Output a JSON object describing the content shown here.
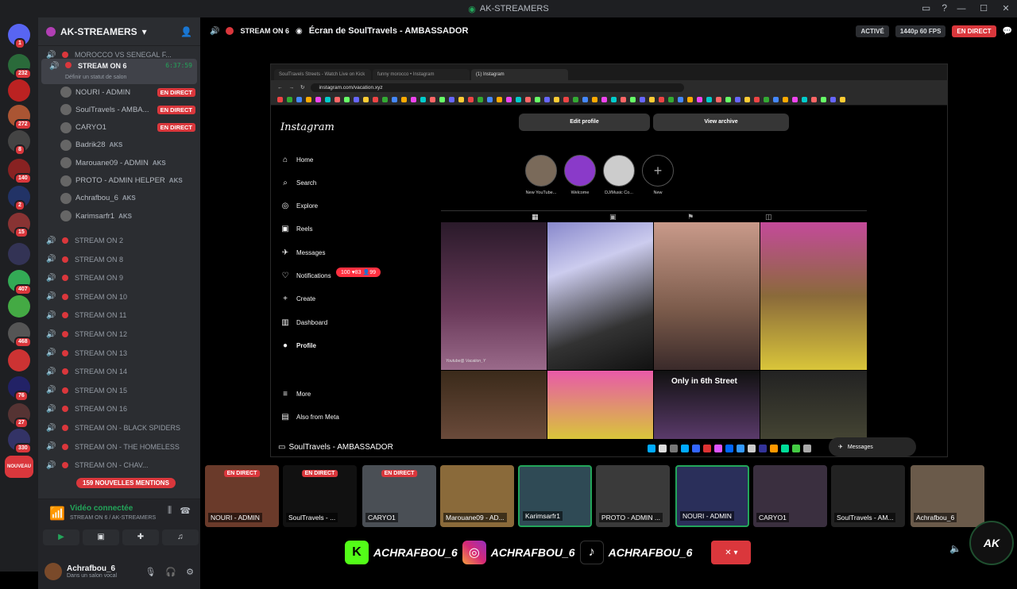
{
  "app": {
    "title": "AK-STREAMERS"
  },
  "colors": {
    "accent_red": "#da373c",
    "green": "#23a55a",
    "bg_dark": "#1e1f22",
    "panel": "#2b2d31"
  },
  "servers": [
    {
      "badge": "1",
      "color": "#5865f2",
      "icon": "discord-icon"
    },
    {
      "badge": "232",
      "color": "#2a6a3a"
    },
    {
      "badge": "",
      "color": "#b22"
    },
    {
      "badge": "272",
      "color": "#a53"
    },
    {
      "badge": "8",
      "color": "#444"
    },
    {
      "badge": "140",
      "color": "#822"
    },
    {
      "badge": "2",
      "color": "#236"
    },
    {
      "badge": "15",
      "color": "#833"
    },
    {
      "badge": "",
      "color": "#335"
    },
    {
      "badge": "407",
      "color": "#3a5"
    },
    {
      "badge": "",
      "color": "#4a4"
    },
    {
      "badge": "468",
      "color": "#555"
    },
    {
      "badge": "",
      "color": "#c33"
    },
    {
      "badge": "76",
      "color": "#226"
    },
    {
      "badge": "27",
      "color": "#533"
    },
    {
      "badge": "330",
      "color": "#336"
    },
    {
      "badge": "NOUVEAU",
      "color": "#da373c"
    }
  ],
  "guild": {
    "name": "AK-STREAMERS"
  },
  "channels": {
    "top": "MOROCCO VS SENEGAL F...",
    "active": {
      "name": "STREAM ON 6",
      "time": "6:37:59",
      "status": "Définir un statut de salon"
    },
    "users": [
      {
        "name": "NOURI - ADMIN",
        "tag": "",
        "live": "EN DIRECT"
      },
      {
        "name": "SoulTravels - AMBA...",
        "tag": "",
        "live": "EN DIRECT"
      },
      {
        "name": "CARYO1",
        "tag": "",
        "live": "EN DIRECT"
      },
      {
        "name": "Badrik28",
        "tag": "AKS",
        "live": ""
      },
      {
        "name": "Marouane09 - ADMIN",
        "tag": "AKS",
        "live": ""
      },
      {
        "name": "PROTO - ADMIN HELPER",
        "tag": "AKS",
        "live": ""
      },
      {
        "name": "Achrafbou_6",
        "tag": "AKS",
        "live": ""
      },
      {
        "name": "Karimsarfr1",
        "tag": "AKS",
        "live": ""
      }
    ],
    "others": [
      "STREAM ON 2",
      "STREAM ON 8",
      "STREAM ON 9",
      "STREAM ON 10",
      "STREAM ON 11",
      "STREAM ON 12",
      "STREAM ON 13",
      "STREAM ON 14",
      "STREAM ON 15",
      "STREAM ON 16",
      "STREAM ON - BLACK SPIDERS",
      "STREAM ON - THE HOMELESS",
      "STREAM ON - CHAV..."
    ],
    "mentions": "159 NOUVELLES MENTIONS"
  },
  "voice": {
    "connected": "Vidéo connectée",
    "sub": "STREAM ON 6 / AK-STREAMERS"
  },
  "user": {
    "name": "Achrafbou_6",
    "status": "Dans un salon vocal"
  },
  "stage": {
    "stream": "STREAM ON 6",
    "ecran": "Écran de SoulTravels - AMBASSADOR",
    "active": "ACTIVÉ",
    "quality": "1440p 60 FPS",
    "live": "EN DIRECT"
  },
  "browser": {
    "tabs": [
      "SoulTravels Streets - Watch Live on Kick",
      "funny morocco • Instagram",
      "(1) Instagram"
    ],
    "url": "instagram.com/vacation.xyz"
  },
  "instagram": {
    "logo": "Instagram",
    "nav": [
      {
        "icon": "home-icon",
        "glyph": "⌂",
        "label": "Home"
      },
      {
        "icon": "search-icon",
        "glyph": "⌕",
        "label": "Search"
      },
      {
        "icon": "explore-icon",
        "glyph": "◎",
        "label": "Explore"
      },
      {
        "icon": "reels-icon",
        "glyph": "▣",
        "label": "Reels"
      },
      {
        "icon": "messages-icon",
        "glyph": "✈",
        "label": "Messages"
      },
      {
        "icon": "heart-icon",
        "glyph": "♡",
        "label": "Notifications"
      },
      {
        "icon": "create-icon",
        "glyph": "+",
        "label": "Create"
      },
      {
        "icon": "dashboard-icon",
        "glyph": "▥",
        "label": "Dashboard"
      },
      {
        "icon": "avatar-icon",
        "glyph": "●",
        "label": "Profile"
      }
    ],
    "more": "More",
    "meta": "Also from Meta",
    "notif_badge": "100 ♥83 👤99",
    "edit_profile": "Edit profile",
    "view_archive": "View archive",
    "highlights": [
      "New YouTube...",
      "Welcome",
      "DJ/Music Co...",
      "New"
    ],
    "post_caption": "Only in 6th Street",
    "messages": "Messages"
  },
  "sharebar": {
    "label": "SoulTravels - AMBASSADOR"
  },
  "thumbs": [
    {
      "name": "NOURI - ADMIN",
      "live": "EN DIRECT",
      "color": "#6a3a2a"
    },
    {
      "name": "SoulTravels - ...",
      "live": "EN DIRECT",
      "color": "#111"
    },
    {
      "name": "CARYO1",
      "live": "EN DIRECT",
      "color": "#4a4f55"
    },
    {
      "name": "Marouane09 - AD...",
      "live": "",
      "color": "#8a6a3a"
    },
    {
      "name": "Karimsarfr1",
      "live": "",
      "color": "#2f4a55"
    },
    {
      "name": "PROTO - ADMIN ...",
      "live": "",
      "color": "#3a3a3a"
    },
    {
      "name": "NOURI - ADMIN",
      "live": "",
      "color": "#2a2f5a"
    },
    {
      "name": "CARYO1",
      "live": "",
      "color": "#3a2f3f"
    },
    {
      "name": "SoulTravels - AM...",
      "live": "",
      "color": "#222"
    },
    {
      "name": "Achrafbou_6",
      "live": "",
      "color": "#6a5a4a"
    }
  ],
  "social": [
    "ACHRAFBOU_6",
    "ACHRAFBOU_6",
    "ACHRAFBOU_6"
  ],
  "ak_logo": "AK"
}
